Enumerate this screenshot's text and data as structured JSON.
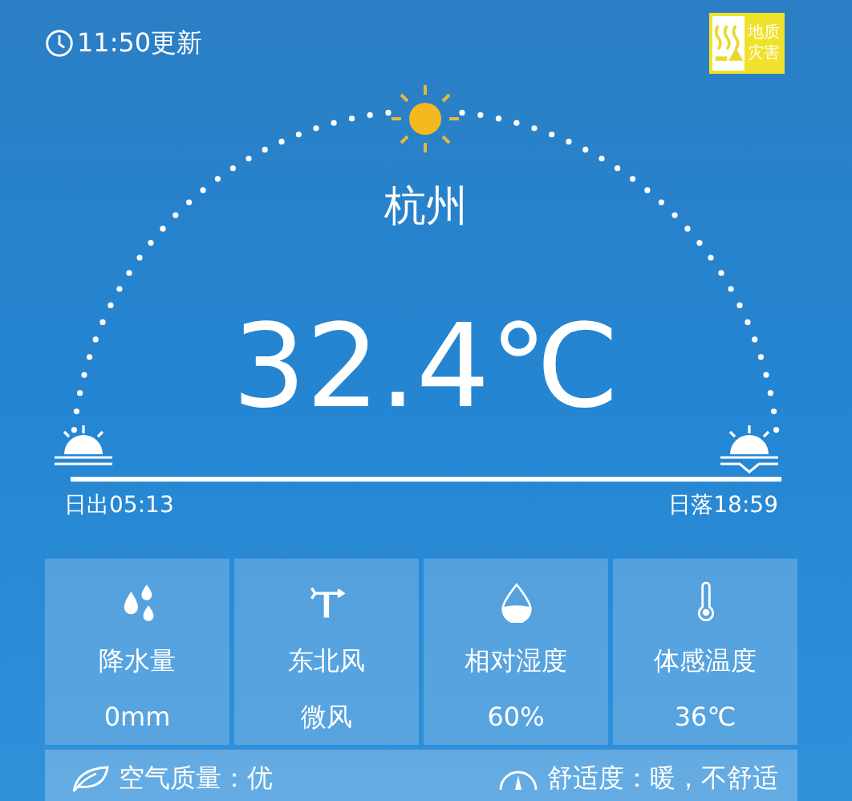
{
  "update": {
    "text": "11:50更新"
  },
  "warning": {
    "lines": [
      "地质",
      "灾害"
    ]
  },
  "city": "杭州",
  "temperature": "32.4℃",
  "sunrise": "日出05:13",
  "sunset": "日落18:59",
  "details": [
    {
      "kind": "rain",
      "label": "降水量",
      "value": "0mm"
    },
    {
      "kind": "wind",
      "label": "东北风",
      "value": "微风"
    },
    {
      "kind": "humidity",
      "label": "相对湿度",
      "value": "60%"
    },
    {
      "kind": "feels",
      "label": "体感温度",
      "value": "36℃"
    }
  ],
  "air": {
    "text": "空气质量：优"
  },
  "comfort": {
    "text": "舒适度：暖，不舒适"
  }
}
